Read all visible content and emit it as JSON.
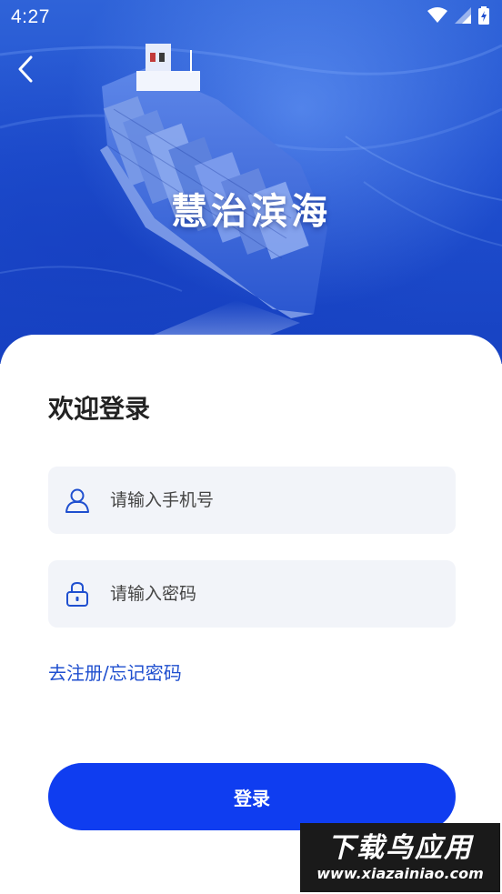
{
  "status_bar": {
    "time": "4:27",
    "icons": [
      "wifi-icon",
      "signal-icon",
      "battery-icon"
    ]
  },
  "header": {
    "back_icon": "chevron-left-icon",
    "title": "慧治滨海"
  },
  "login": {
    "welcome": "欢迎登录",
    "phone_placeholder": "请输入手机号",
    "phone_icon": "user-icon",
    "password_placeholder": "请输入密码",
    "password_icon": "lock-icon",
    "register_link": "去注册/",
    "forgot_link": " 忘记密码",
    "submit_label": "登录"
  },
  "watermark": {
    "main": "下载鸟应用",
    "sub": "www.xiazainiao.com"
  },
  "colors": {
    "primary": "#0f3df0",
    "link": "#1f4fcf",
    "field_bg": "#f2f4f9",
    "hero_blue": "#1f4fcf"
  }
}
